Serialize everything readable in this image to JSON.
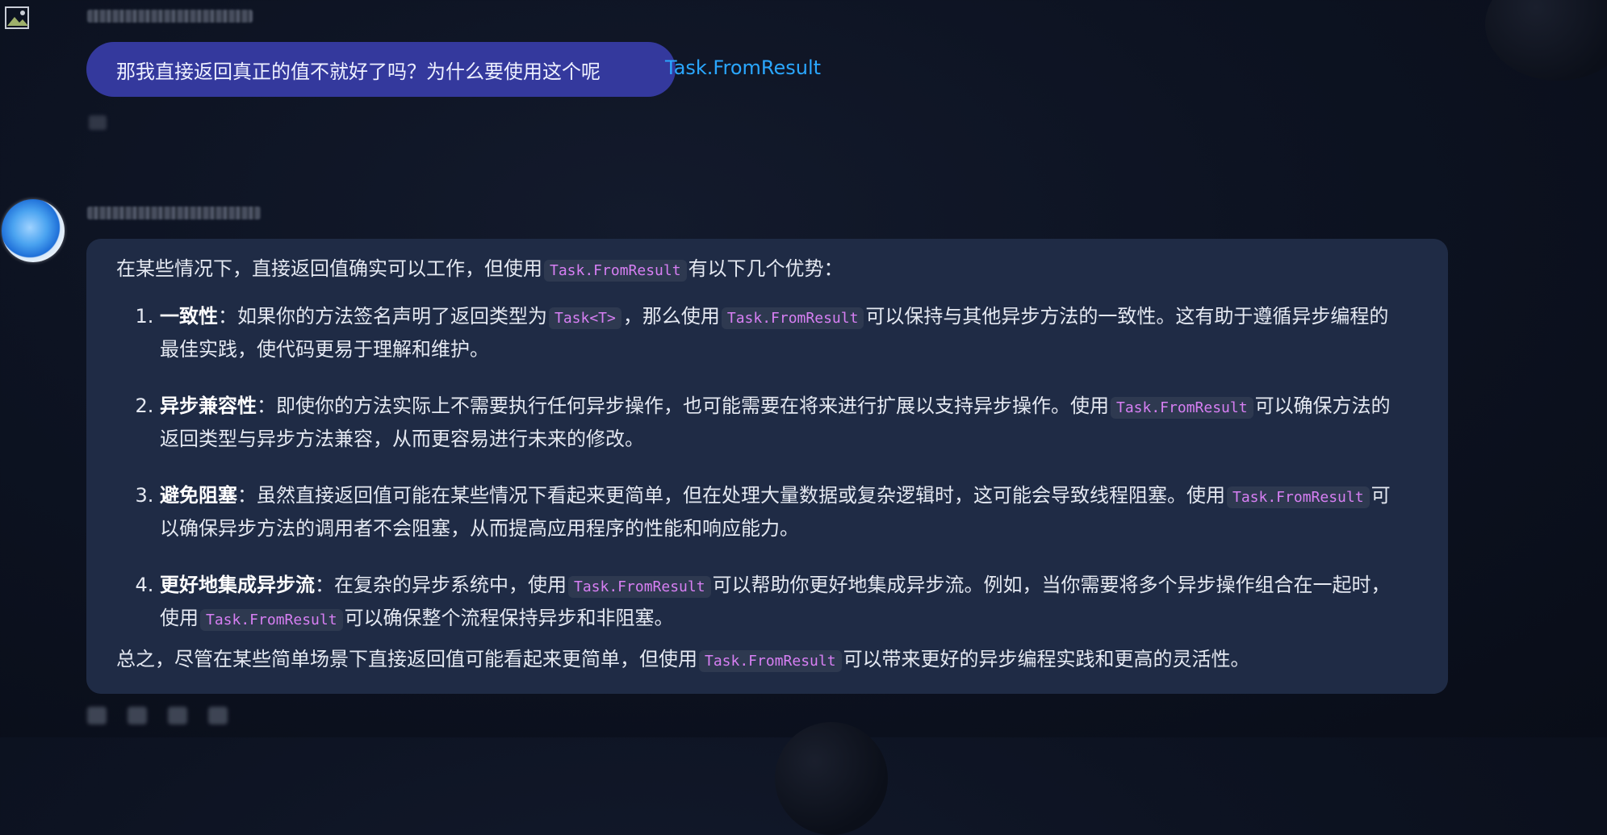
{
  "user_message": {
    "text": "那我直接返回真正的值不就好了吗？为什么要使用这个呢",
    "code": "Task.FromResult"
  },
  "assistant_message": {
    "intro_before": "在某些情况下，直接返回值确实可以工作，但使用",
    "intro_code": "Task.FromResult",
    "intro_after": "有以下几个优势：",
    "items": [
      {
        "title": "一致性",
        "text_1": "：如果你的方法签名声明了返回类型为",
        "code_1": "Task<T>",
        "text_2": "，那么使用",
        "code_2": "Task.FromResult",
        "text_3": "可以保持与其他异步方法的一致性。这有助于遵循异步编程的最佳实践，使代码更易于理解和维护。"
      },
      {
        "title": "异步兼容性",
        "text_1": "：即使你的方法实际上不需要执行任何异步操作，也可能需要在将来进行扩展以支持异步操作。使用",
        "code_1": "Task.FromResult",
        "text_2": "可以确保方法的返回类型与异步方法兼容，从而更容易进行未来的修改。"
      },
      {
        "title": "避免阻塞",
        "text_1": "：虽然直接返回值可能在某些情况下看起来更简单，但在处理大量数据或复杂逻辑时，这可能会导致线程阻塞。使用",
        "code_1": "Task.FromResult",
        "text_2": "可以确保异步方法的调用者不会阻塞，从而提高应用程序的性能和响应能力。"
      },
      {
        "title": "更好地集成异步流",
        "text_1": "：在复杂的异步系统中，使用",
        "code_1": "Task.FromResult",
        "text_2": "可以帮助你更好地集成异步流。例如，当你需要将多个异步操作组合在一起时，使用",
        "code_2": "Task.FromResult",
        "text_3": "可以确保整个流程保持异步和非阻塞。"
      }
    ],
    "summary_before": "总之，尽管在某些简单场景下直接返回值可能看起来更简单，但使用",
    "summary_code": "Task.FromResult",
    "summary_after": "可以带来更好的异步编程实践和更高的灵活性。"
  },
  "colors": {
    "background": "#0d1322",
    "user_bubble": "#34399d",
    "assistant_bubble": "#1f2b45",
    "code_text": "#d77ff3",
    "code_bg": "#2e3950",
    "link": "#2aa7ff"
  },
  "icons": {
    "user_avatar": "broken-image-icon",
    "assistant_avatar": "globe-avatar",
    "actions": [
      "copy-icon",
      "thumbs-up-icon",
      "thumbs-down-icon",
      "more-icon"
    ]
  }
}
